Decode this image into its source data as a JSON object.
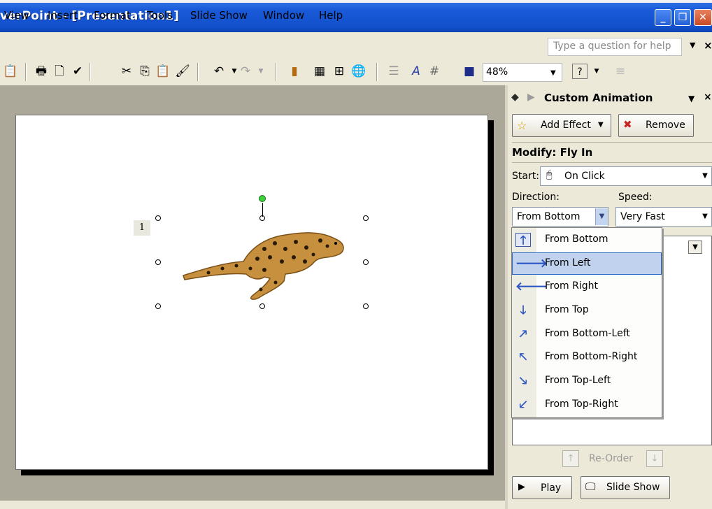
{
  "window": {
    "title": "verPoint - [Presentation1]",
    "buttons": {
      "minimize": "_",
      "restore": "❐",
      "close": "✕"
    }
  },
  "menu": {
    "items": [
      "View",
      "Insert",
      "Format",
      "Tools",
      "Slide Show",
      "Window",
      "Help"
    ],
    "help_placeholder": "Type a question for help"
  },
  "toolbar": {
    "zoom": "48%",
    "icons": [
      "clipboard-icon",
      "print-icon",
      "print-preview-icon",
      "spelling-icon",
      "cut-icon",
      "copy-icon",
      "paste-icon",
      "format-painter-icon",
      "undo-icon",
      "redo-icon",
      "insert-chart-icon",
      "insert-table-icon",
      "tables-borders-icon",
      "insert-hyperlink-icon",
      "expand-icon",
      "show-formatting-icon",
      "grid-icon",
      "color-icon",
      "help-icon"
    ]
  },
  "slide": {
    "animation_tag": "1",
    "image": "cheetah-clipart"
  },
  "task_pane": {
    "title": "Custom Animation",
    "add_effect": "Add Effect",
    "remove": "Remove",
    "modify_heading": "Modify: Fly In",
    "start_label": "Start:",
    "start_value": "On Click",
    "direction_label": "Direction:",
    "direction_value": "From Bottom",
    "speed_label": "Speed:",
    "speed_value": "Very Fast",
    "reorder_label": "Re-Order",
    "play": "Play",
    "slide_show": "Slide Show"
  },
  "direction_menu": {
    "items": [
      {
        "label": "From Bottom",
        "icon": "arrow-up-icon",
        "glyph": "🡑",
        "checked": true
      },
      {
        "label": "From Left",
        "icon": "arrow-right-icon",
        "glyph": "🡒",
        "selected": true
      },
      {
        "label": "From Right",
        "icon": "arrow-left-icon",
        "glyph": "🡐"
      },
      {
        "label": "From Top",
        "icon": "arrow-down-icon",
        "glyph": "🡓"
      },
      {
        "label": "From Bottom-Left",
        "icon": "arrow-up-right-icon",
        "glyph": "🡕"
      },
      {
        "label": "From Bottom-Right",
        "icon": "arrow-up-left-icon",
        "glyph": "🡔"
      },
      {
        "label": "From Top-Left",
        "icon": "arrow-down-right-icon",
        "glyph": "🡖"
      },
      {
        "label": "From Top-Right",
        "icon": "arrow-down-left-icon",
        "glyph": "🡗"
      }
    ]
  }
}
